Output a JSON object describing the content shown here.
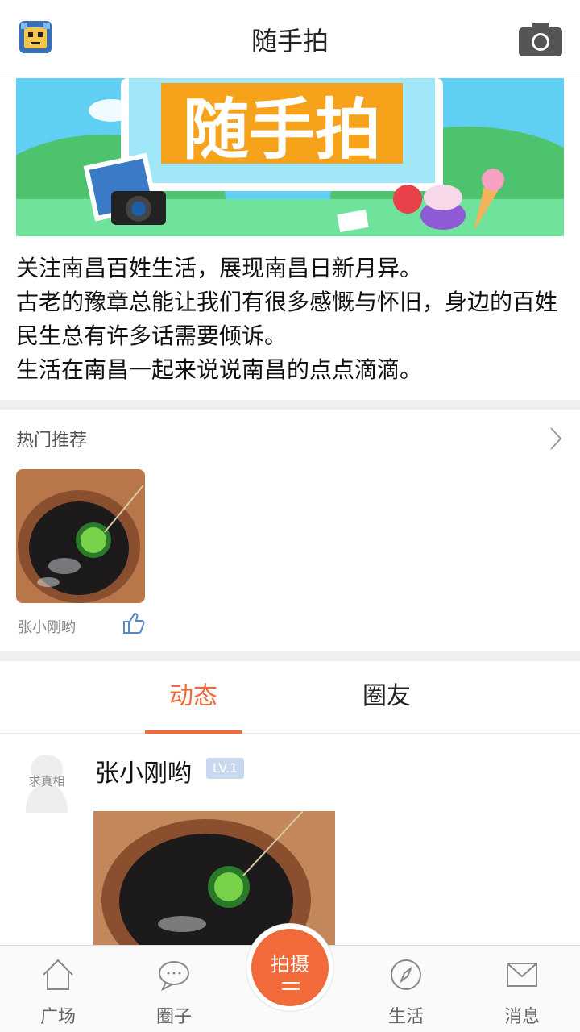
{
  "header": {
    "title": "随手拍",
    "left_icon": "app-logo-avatar",
    "right_icon": "camera-icon"
  },
  "banner": {
    "text": "随手拍"
  },
  "intro": {
    "lines": [
      "关注南昌百姓生活，展现南昌日新月异。",
      "古老的豫章总能让我们有很多感慨与怀旧，身边的百姓民生总有许多话需要倾诉。",
      "生活在南昌一起来说说南昌的点点滴滴。"
    ]
  },
  "hot": {
    "title": "热门推荐",
    "item": {
      "user": "张小刚哟"
    }
  },
  "tabs": [
    {
      "label": "动态",
      "active": true
    },
    {
      "label": "圈友",
      "active": false
    }
  ],
  "post": {
    "avatar_text": "求真相",
    "user": "张小刚哟",
    "level": "LV.1"
  },
  "nav": {
    "items": [
      {
        "label": "广场",
        "icon": "house-icon"
      },
      {
        "label": "圈子",
        "icon": "chat-bubble-icon"
      },
      {
        "label": "生活",
        "icon": "compass-icon"
      },
      {
        "label": "消息",
        "icon": "mail-icon"
      }
    ],
    "shoot_label": "拍摄"
  },
  "colors": {
    "accent": "#f06a3b",
    "level_badge": "#c8d8ef"
  }
}
